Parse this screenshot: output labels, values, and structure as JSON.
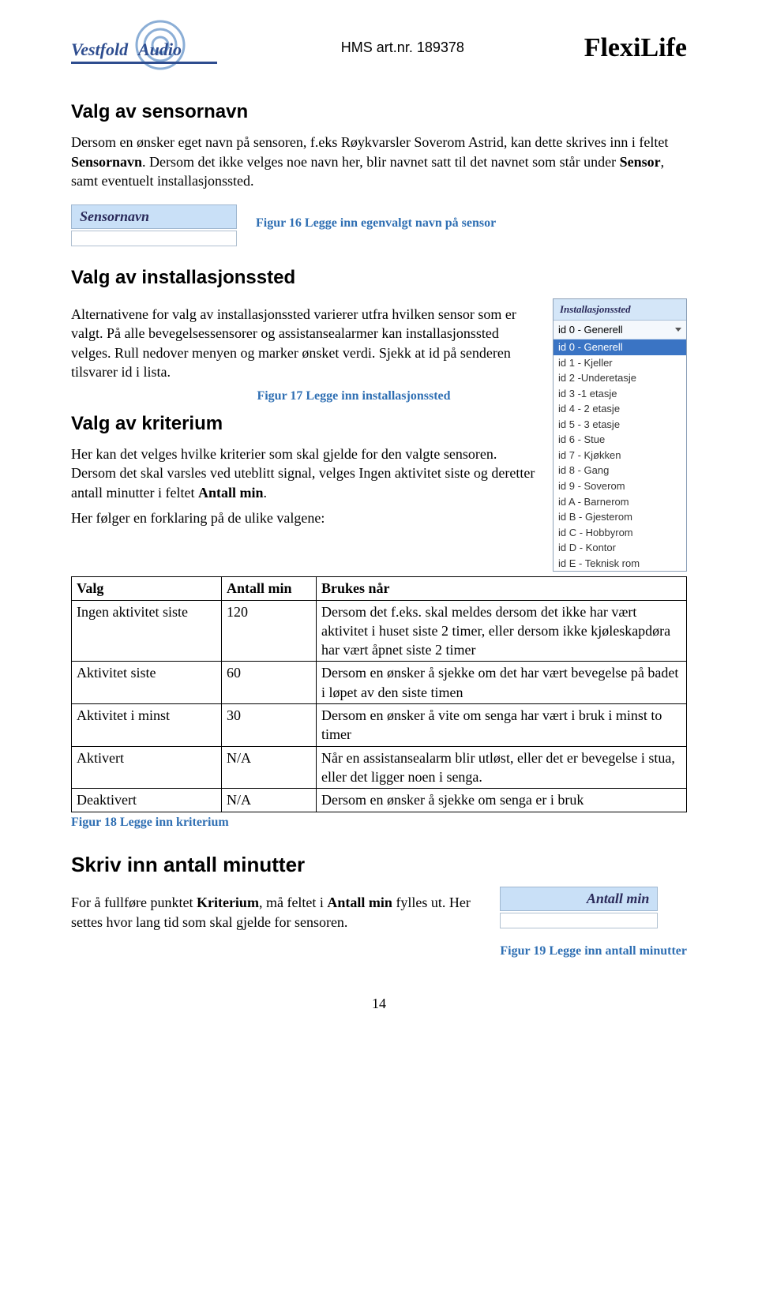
{
  "header": {
    "logo_word1": "Vestfold",
    "logo_word2": "Audio",
    "hms": "HMS art.nr. 189378",
    "brand": "FlexiLife"
  },
  "s1": {
    "title": "Valg av sensornavn",
    "p1a": "Dersom en ønsker eget navn på sensoren, f.eks Røykvarsler Soverom Astrid, kan dette skrives inn i feltet ",
    "p1b": "Sensornavn",
    "p1c": ". Dersom det ikke velges noe navn her, blir navnet satt til det navnet som står under ",
    "p1d": "Sensor",
    "p1e": ", samt eventuelt installasjonssted."
  },
  "sensor_widget": {
    "label": "Sensornavn"
  },
  "fig16": "Figur 16 Legge inn egenvalgt navn på sensor",
  "s2": {
    "title": "Valg av installasjonssted",
    "p": "Alternativene for valg av installasjonssted varierer utfra hvilken sensor som er valgt. På alle bevegelsessensorer og assistansealarmer kan installasjonssted velges. Rull nedover menyen og marker ønsket verdi. Sjekk at id på senderen tilsvarer id i lista."
  },
  "dropdown": {
    "title": "Installasjonssted",
    "selected": "id 0 - Generell",
    "options": [
      "id 0 - Generell",
      "id 1 - Kjeller",
      "id 2 -Underetasje",
      "id 3 -1 etasje",
      "id 4 - 2 etasje",
      "id 5 - 3 etasje",
      "id 6 - Stue",
      "id 7 - Kjøkken",
      "id 8 - Gang",
      "id 9 - Soverom",
      "id A - Barnerom",
      "id B - Gjesterom",
      "id C - Hobbyrom",
      "id D - Kontor",
      "id E - Teknisk rom"
    ]
  },
  "fig17": "Figur 17 Legge inn installasjonssted",
  "s3": {
    "title": "Valg av kriterium",
    "p_a": "Her kan det velges hvilke kriterier som skal gjelde for den valgte sensoren. Dersom det skal varsles ved uteblitt signal, velges Ingen aktivitet siste og deretter antall minutter i feltet ",
    "p_b": "Antall min",
    "p_c": ".",
    "p2": "Her følger en forklaring på de ulike valgene:"
  },
  "table": {
    "h1": "Valg",
    "h2": "Antall min",
    "h3": "Brukes når",
    "rows": [
      {
        "c1": "Ingen aktivitet siste",
        "c2": "120",
        "c3": "Dersom det f.eks. skal meldes dersom det ikke har vært aktivitet i huset siste 2 timer, eller dersom ikke kjøleskapdøra har vært åpnet siste 2 timer"
      },
      {
        "c1": "Aktivitet siste",
        "c2": "60",
        "c3": "Dersom en ønsker å sjekke om det har vært bevegelse på badet i løpet av den siste timen"
      },
      {
        "c1": "Aktivitet i minst",
        "c2": "30",
        "c3": "Dersom en ønsker å vite om senga har vært i bruk i minst to timer"
      },
      {
        "c1": "Aktivert",
        "c2": "N/A",
        "c3": "Når en assistansealarm blir utløst, eller det er bevegelse i stua, eller det ligger noen i senga."
      },
      {
        "c1": "Deaktivert",
        "c2": "N/A",
        "c3": "Dersom en ønsker å sjekke om senga er i bruk"
      }
    ]
  },
  "fig18": "Figur 18 Legge inn kriterium",
  "s4": {
    "title": "Skriv inn antall minutter",
    "p_a": "For å fullføre punktet ",
    "p_b": "Kriterium",
    "p_c": ", må feltet i ",
    "p_d": "Antall min",
    "p_e": " fylles ut. Her settes hvor lang tid som skal gjelde for sensoren."
  },
  "antall_widget": {
    "label": "Antall min"
  },
  "fig19": "Figur 19 Legge inn antall minutter",
  "page_number": "14"
}
